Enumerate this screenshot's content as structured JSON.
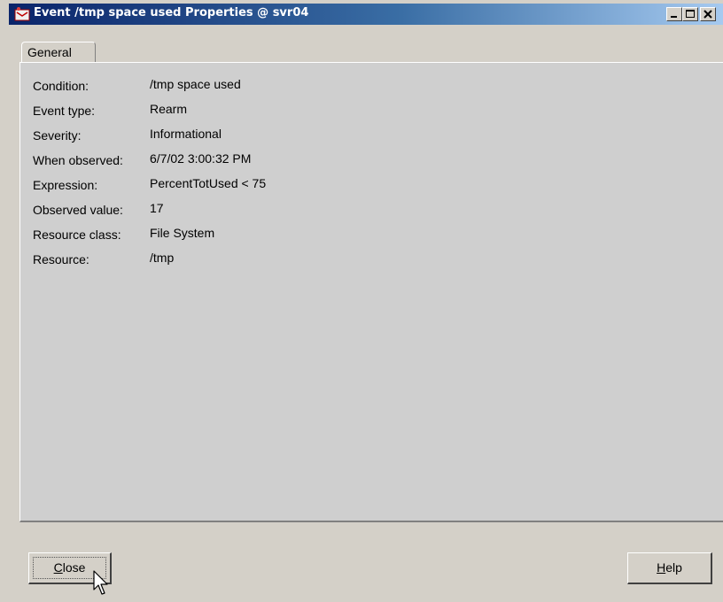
{
  "window": {
    "title": "Event /tmp space used Properties @ svr04"
  },
  "tabs": [
    {
      "label": "General"
    }
  ],
  "properties": [
    {
      "label": "Condition:",
      "value": "/tmp space used"
    },
    {
      "label": "Event type:",
      "value": "Rearm"
    },
    {
      "label": "Severity:",
      "value": "Informational"
    },
    {
      "label": "When observed:",
      "value": "6/7/02 3:00:32 PM"
    },
    {
      "label": "Expression:",
      "value": "PercentTotUsed < 75"
    },
    {
      "label": "Observed value:",
      "value": "17"
    },
    {
      "label": "Resource class:",
      "value": "File System"
    },
    {
      "label": "Resource:",
      "value": "/tmp"
    }
  ],
  "buttons": {
    "close": {
      "label_underlined": "C",
      "label_rest": "lose"
    },
    "help": {
      "label_underlined": "H",
      "label_rest": "elp"
    }
  },
  "icons": [
    "app-icon",
    "minimize-icon",
    "maximize-icon",
    "close-icon",
    "mouse-cursor-icon"
  ]
}
